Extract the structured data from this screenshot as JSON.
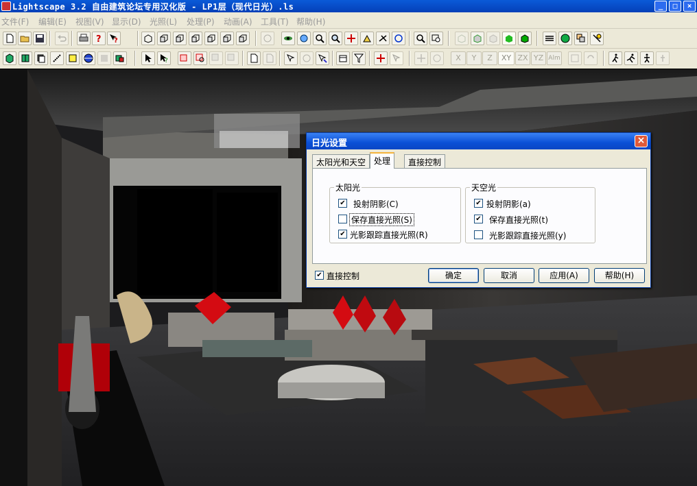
{
  "titlebar": {
    "title": "Lightscape 3.2 自由建筑论坛专用汉化版  - LP1层（现代日光）.ls",
    "min": "_",
    "max": "□",
    "close": "×"
  },
  "menu": [
    {
      "label": "文件(F)"
    },
    {
      "label": "编辑(E)"
    },
    {
      "label": "视图(V)"
    },
    {
      "label": "显示(D)"
    },
    {
      "label": "光照(L)"
    },
    {
      "label": "处理(P)"
    },
    {
      "label": "动画(A)"
    },
    {
      "label": "工具(T)"
    },
    {
      "label": "帮助(H)"
    }
  ],
  "axis_buttons": [
    "X",
    "Y",
    "Z",
    "XY",
    "ZX",
    "YZ",
    "Alm"
  ],
  "dialog": {
    "title": "日光设置",
    "close": "×",
    "tabs": [
      {
        "label": "太阳光和天空"
      },
      {
        "label": "处理"
      },
      {
        "label": "直接控制"
      }
    ],
    "sun_group": {
      "title": "太阳光",
      "items": [
        {
          "label": "投射阴影(C)",
          "checked": true
        },
        {
          "label": "保存直接光照(S)",
          "checked": false
        },
        {
          "label": "光影跟踪直接光照(R)",
          "checked": true
        }
      ]
    },
    "sky_group": {
      "title": "天空光",
      "items": [
        {
          "label": "投射阴影(a)",
          "checked": true
        },
        {
          "label": "保存直接光照(t)",
          "checked": true
        },
        {
          "label": "光影跟踪直接光照(y)",
          "checked": false
        }
      ]
    },
    "direct_control": {
      "label": "直接控制",
      "checked": true
    },
    "buttons": {
      "ok": "确定",
      "cancel": "取消",
      "apply": "应用(A)",
      "help": "帮助(H)"
    }
  },
  "colors": {
    "title_blue": "#0a4fd6",
    "panel": "#ece9d8",
    "scene_bg": "#1c1c1e",
    "cushion_red": "#d40b12"
  }
}
